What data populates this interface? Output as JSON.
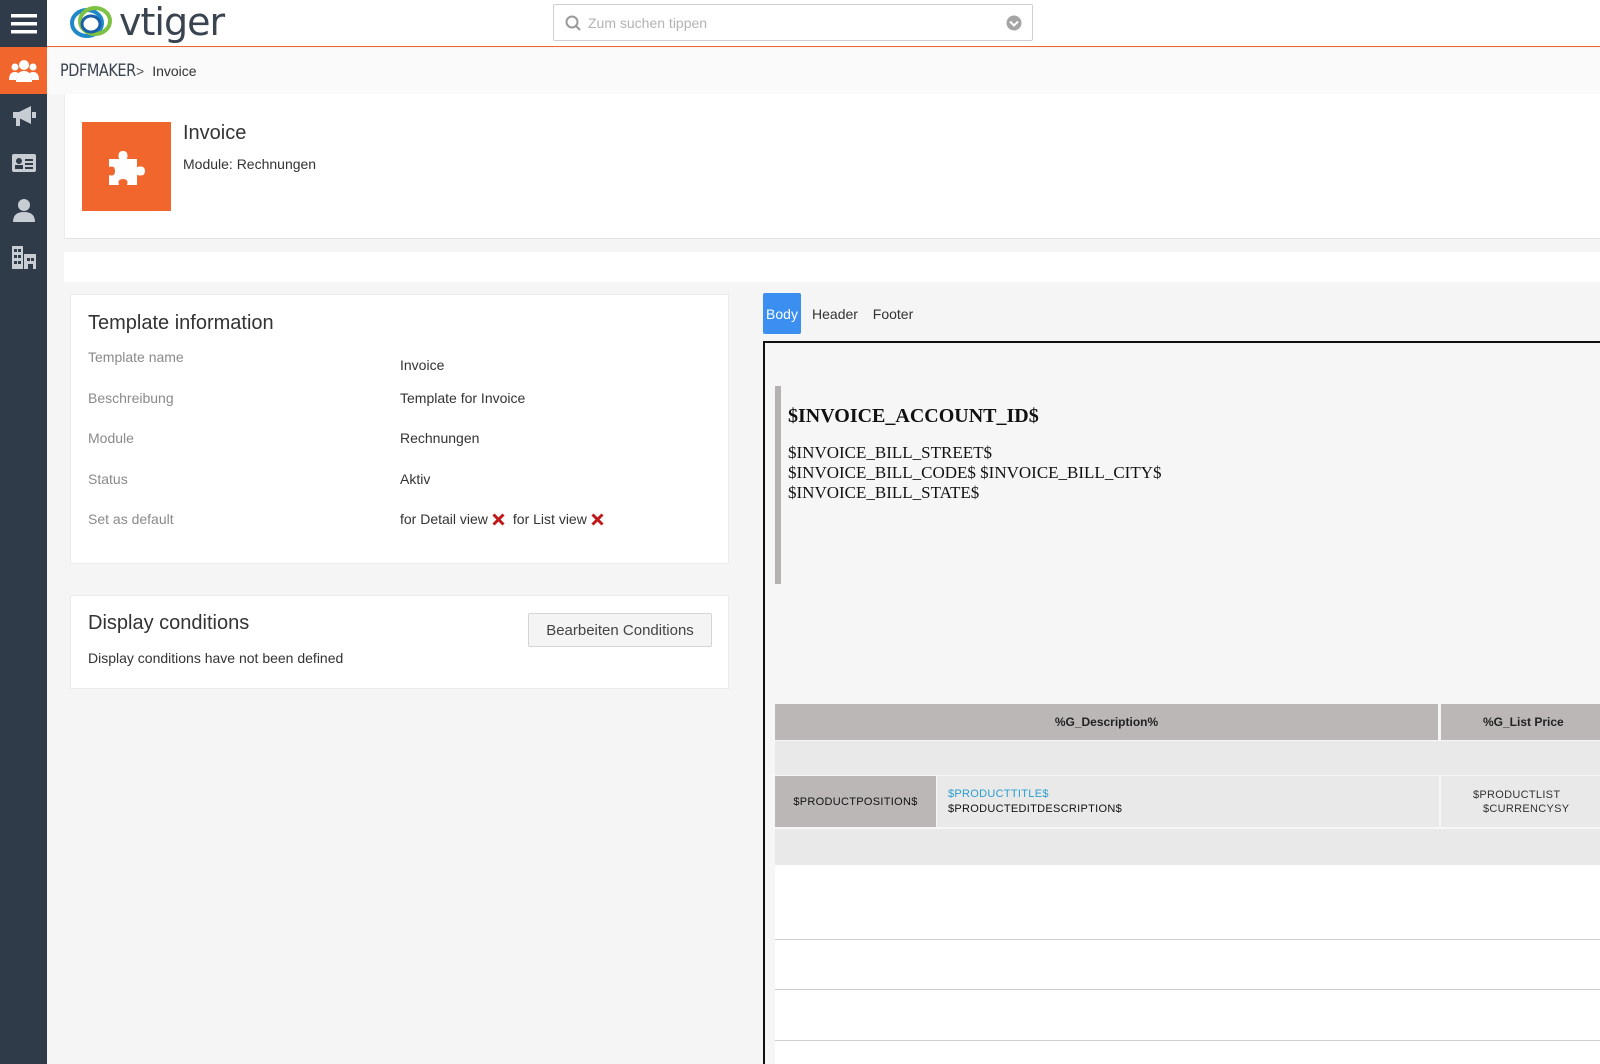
{
  "app": {
    "logo_text": "vtiger",
    "brand_color": "#f0662c",
    "accent_color": "#3b8ff0",
    "sidebar_color": "#2f3b48"
  },
  "sidebar": {
    "items": [
      {
        "icon": "menu-icon",
        "active": false
      },
      {
        "icon": "users-icon",
        "active": true
      },
      {
        "icon": "megaphone-icon",
        "active": false
      },
      {
        "icon": "contact-card-icon",
        "active": false
      },
      {
        "icon": "person-icon",
        "active": false
      },
      {
        "icon": "building-icon",
        "active": false
      }
    ]
  },
  "search": {
    "placeholder": "Zum suchen tippen",
    "value": ""
  },
  "breadcrumb": {
    "module": "PDFMAKER",
    "separator": ">",
    "current": "Invoice"
  },
  "record": {
    "title": "Invoice",
    "subtitle": "Module: Rechnungen"
  },
  "template_info": {
    "title": "Template information",
    "rows": [
      {
        "label": "Template name",
        "value": "Invoice"
      },
      {
        "label": "Beschreibung",
        "value": "Template for Invoice"
      },
      {
        "label": "Module",
        "value": "Rechnungen"
      },
      {
        "label": "Status",
        "value": "Aktiv"
      },
      {
        "label": "Set as default",
        "detail_view": "for Detail view",
        "list_view": "for List view"
      }
    ]
  },
  "display_conditions": {
    "title": "Display conditions",
    "button": "Bearbeiten Conditions",
    "message": "Display conditions have not been defined"
  },
  "tabs": [
    {
      "label": "Body",
      "active": true
    },
    {
      "label": "Header",
      "active": false
    },
    {
      "label": "Footer",
      "active": false
    }
  ],
  "editor": {
    "account_id": "$INVOICE_ACCOUNT_ID$",
    "address_lines": [
      "$INVOICE_BILL_STREET$",
      "$INVOICE_BILL_CODE$ $INVOICE_BILL_CITY$",
      "$INVOICE_BILL_STATE$"
    ],
    "table": {
      "headers": [
        "%G_Description%",
        "%G_List Price"
      ],
      "row": {
        "position": "$PRODUCTPOSITION$",
        "title": "$PRODUCTTITLE$",
        "edit_description": "$PRODUCTEDITDESCRIPTION$",
        "list_price": "$PRODUCTLIST",
        "currency": "$CURRENCYSY"
      }
    }
  }
}
